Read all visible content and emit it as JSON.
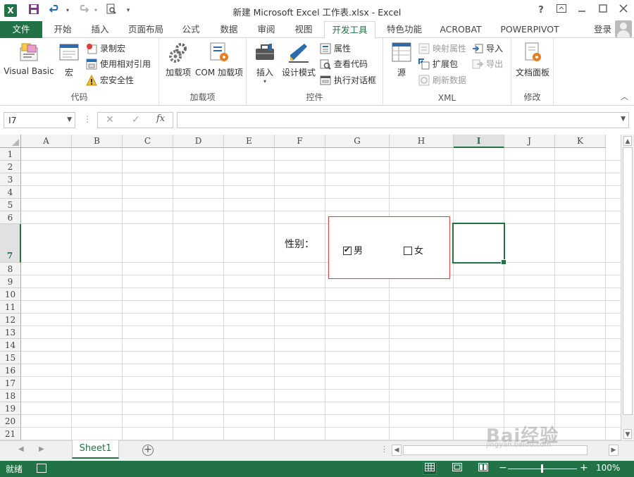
{
  "titlebar": {
    "app_icon": "X",
    "title": "新建 Microsoft Excel 工作表.xlsx - Excel",
    "quick_access": [
      "save-icon",
      "undo-icon",
      "redo-icon",
      "print-preview-icon",
      "customize-icon"
    ],
    "help": "?",
    "window_buttons": [
      "ribbon-display-icon",
      "minimize-icon",
      "maximize-icon",
      "close-icon"
    ]
  },
  "tabs": {
    "file": "文件",
    "items": [
      "开始",
      "插入",
      "页面布局",
      "公式",
      "数据",
      "审阅",
      "视图",
      "开发工具",
      "特色功能",
      "ACROBAT",
      "POWERPIVOT"
    ],
    "active": "开发工具",
    "login": "登录"
  },
  "ribbon": {
    "groups": {
      "code": {
        "label": "代码",
        "visual_basic": "Visual Basic",
        "macros": "宏",
        "record_macro": "录制宏",
        "relative_ref": "使用相对引用",
        "macro_security": "宏安全性"
      },
      "addins": {
        "label": "加载项",
        "addins": "加载项",
        "com_addins": "COM 加载项"
      },
      "controls": {
        "label": "控件",
        "insert": "插入",
        "design_mode": "设计模式",
        "properties": "属性",
        "view_code": "查看代码",
        "run_dialog": "执行对话框"
      },
      "xml": {
        "label": "XML",
        "source": "源",
        "map_properties": "映射属性",
        "expansion_packs": "扩展包",
        "refresh_data": "刷新数据",
        "import": "导入",
        "export": "导出"
      },
      "modify": {
        "label": "修改",
        "document_panel": "文档面板"
      }
    }
  },
  "formula_bar": {
    "name_box": "I7",
    "cancel": "✕",
    "enter": "✓",
    "fx": "fx",
    "formula": ""
  },
  "sheet": {
    "columns": [
      "A",
      "B",
      "C",
      "D",
      "E",
      "F",
      "G",
      "H",
      "I",
      "J",
      "K"
    ],
    "rows": [
      "1",
      "2",
      "3",
      "4",
      "5",
      "6",
      "7",
      "8",
      "9",
      "10",
      "11",
      "12",
      "13",
      "14",
      "15",
      "16",
      "17",
      "18",
      "19",
      "20",
      "21"
    ],
    "selected_col": "I",
    "selected_row": "7",
    "gender_label": "性别：",
    "checkboxes": [
      {
        "label": "男",
        "checked": true
      },
      {
        "label": "女",
        "checked": false
      }
    ]
  },
  "sheet_tabs": {
    "active": "Sheet1",
    "add": "+"
  },
  "status": {
    "ready": "就绪",
    "zoom": "100%",
    "zoom_minus": "−",
    "zoom_plus": "+",
    "zoom_fraction": 0.5
  },
  "watermark": {
    "big": "Bai经验",
    "small": "jingyan.baidu.com"
  }
}
